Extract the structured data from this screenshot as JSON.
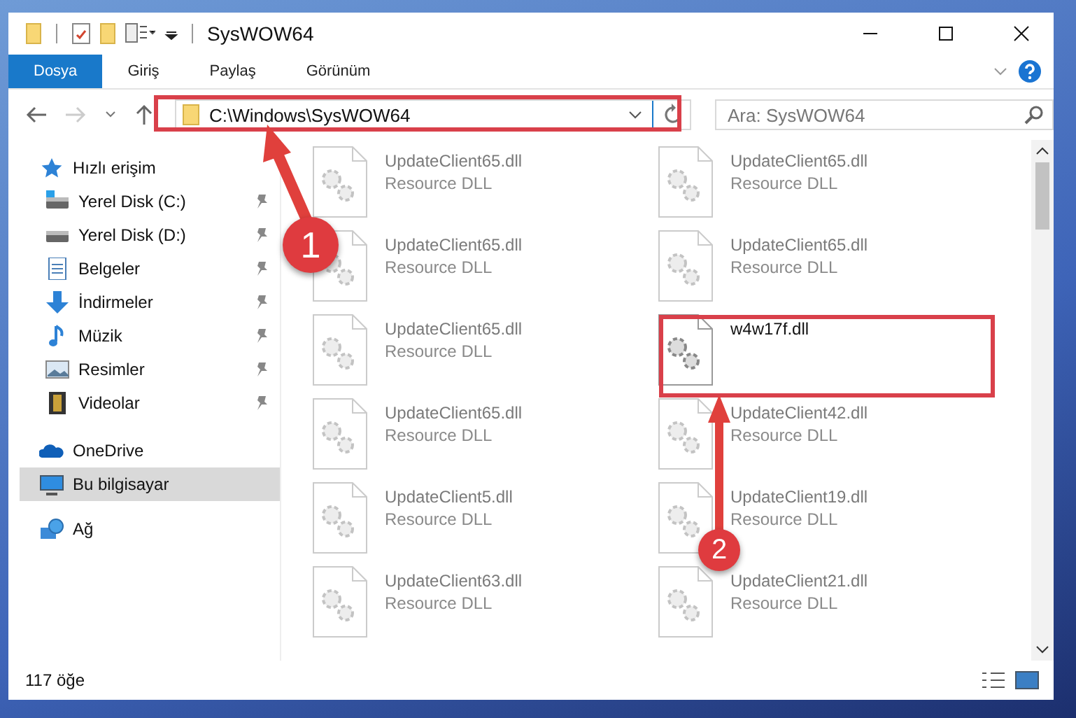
{
  "window": {
    "title": "SysWOW64"
  },
  "ribbon_tabs": [
    {
      "label": "Dosya",
      "selected": true
    },
    {
      "label": "Giriş",
      "selected": false
    },
    {
      "label": "Paylaş",
      "selected": false
    },
    {
      "label": "Görünüm",
      "selected": false
    }
  ],
  "address_bar": {
    "path": "C:\\Windows\\SysWOW64"
  },
  "search": {
    "placeholder": "Ara: SysWOW64"
  },
  "sidebar": {
    "items": [
      {
        "label": "Hızlı erişim",
        "selected": false,
        "children": [
          {
            "label": "Yerel Disk (C:)",
            "pinned": true
          },
          {
            "label": "Yerel Disk (D:)",
            "pinned": true
          },
          {
            "label": "Belgeler",
            "pinned": true
          },
          {
            "label": "İndirmeler",
            "pinned": true
          },
          {
            "label": "Müzik",
            "pinned": true
          },
          {
            "label": "Resimler",
            "pinned": true
          },
          {
            "label": "Videolar",
            "pinned": true
          }
        ]
      },
      {
        "label": "OneDrive",
        "selected": false
      },
      {
        "label": "Bu bilgisayar",
        "selected": true
      },
      {
        "label": "Ağ",
        "selected": false
      }
    ]
  },
  "files": [
    {
      "name": "UpdateClient65.dll",
      "type": "Resource DLL",
      "faded": true
    },
    {
      "name": "UpdateClient65.dll",
      "type": "Resource DLL",
      "faded": true
    },
    {
      "name": "UpdateClient65.dll",
      "type": "Resource DLL",
      "faded": true
    },
    {
      "name": "UpdateClient65.dll",
      "type": "Resource DLL",
      "faded": true
    },
    {
      "name": "UpdateClient65.dll",
      "type": "Resource DLL",
      "faded": true
    },
    {
      "name": "w4w17f.dll",
      "faded": false
    },
    {
      "name": "UpdateClient65.dll",
      "type": "Resource DLL",
      "faded": true
    },
    {
      "name": "UpdateClient42.dll",
      "type": "Resource DLL",
      "faded": true
    },
    {
      "name": "UpdateClient5.dll",
      "type": "Resource DLL",
      "faded": true
    },
    {
      "name": "UpdateClient19.dll",
      "type": "Resource DLL",
      "faded": true
    },
    {
      "name": "UpdateClient63.dll",
      "type": "Resource DLL",
      "faded": true
    },
    {
      "name": "UpdateClient21.dll",
      "type": "Resource DLL",
      "faded": true
    }
  ],
  "status_bar": {
    "item_count": "117 öğe"
  },
  "annotations": [
    {
      "number": "1"
    },
    {
      "number": "2"
    }
  ]
}
